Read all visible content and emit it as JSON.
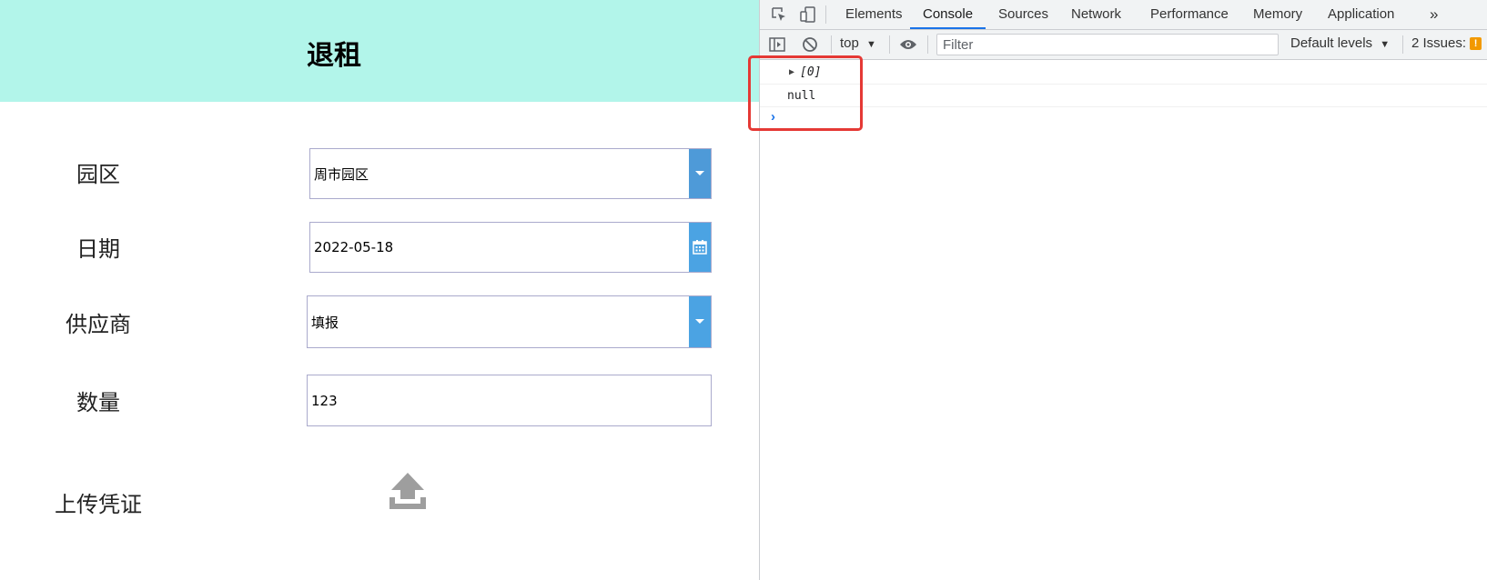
{
  "app": {
    "title": "退租",
    "fields": {
      "park": {
        "label": "园区",
        "value": "周市园区"
      },
      "date": {
        "label": "日期",
        "value": "2022-05-18"
      },
      "supplier": {
        "label": "供应商",
        "value": "填报"
      },
      "quantity": {
        "label": "数量",
        "value": "123"
      },
      "upload": {
        "label": "上传凭证"
      }
    },
    "colors": {
      "header_bg": "#b2f5ea",
      "select_button": "#4e9ad8",
      "date_button": "#4ba3e3"
    },
    "icons": {
      "dropdown": "chevron-down-icon",
      "date": "calendar-icon",
      "upload": "upload-icon"
    }
  },
  "devtools": {
    "tabs": [
      {
        "label": "Elements"
      },
      {
        "label": "Console",
        "active": true
      },
      {
        "label": "Sources"
      },
      {
        "label": "Network"
      },
      {
        "label": "Performance"
      },
      {
        "label": "Memory"
      },
      {
        "label": "Application"
      }
    ],
    "more_tabs_glyph": "»",
    "toolbar": {
      "context": "top",
      "filter_placeholder": "Filter",
      "levels": "Default levels",
      "issues": "2 Issues:"
    },
    "console": {
      "lines": [
        "[0]",
        "null"
      ],
      "prompt": "›"
    },
    "colors": {
      "active_tab": "#1a73e8",
      "highlight_box": "#e53935",
      "issues_badge": "#f29900"
    }
  }
}
